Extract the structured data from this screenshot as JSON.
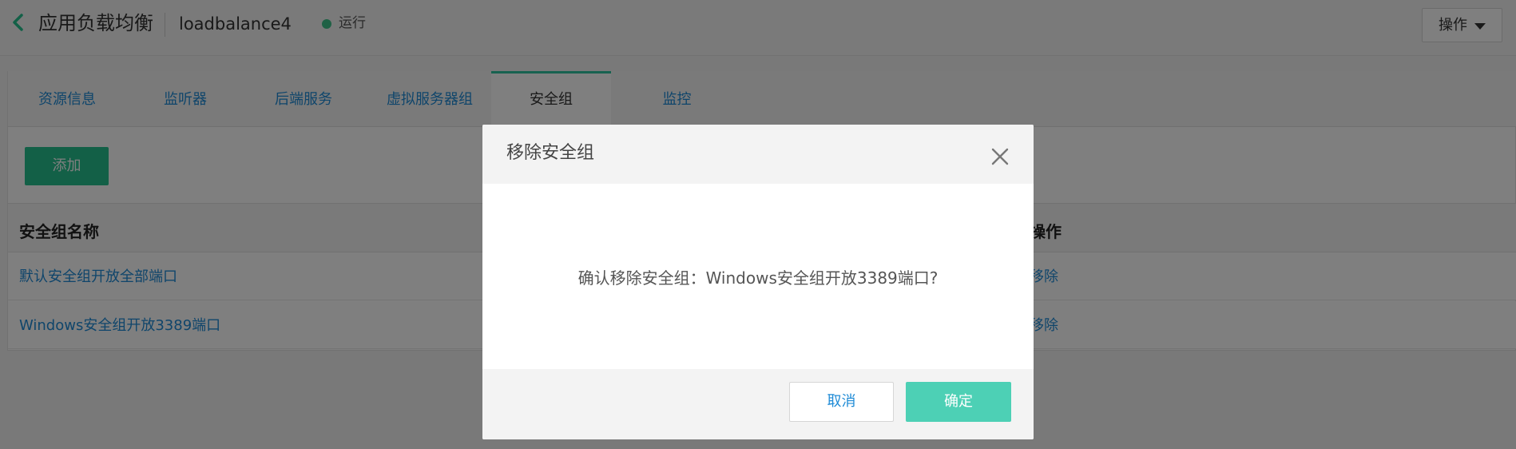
{
  "header": {
    "title": "应用负载均衡",
    "lb_name": "loadbalance4",
    "status": "运行",
    "status_color": "#3fc38a",
    "ops_label": "操作",
    "back_icon": "chevron-left-icon"
  },
  "tabs": [
    {
      "label": "资源信息",
      "active": false
    },
    {
      "label": "监听器",
      "active": false
    },
    {
      "label": "后端服务",
      "active": false
    },
    {
      "label": "虚拟服务器组",
      "active": false
    },
    {
      "label": "安全组",
      "active": true
    },
    {
      "label": "监控",
      "active": false
    }
  ],
  "toolbar": {
    "add_label": "添加"
  },
  "table": {
    "columns": [
      "安全组名称",
      "操作"
    ],
    "rows": [
      {
        "name": "默认安全组开放全部端口",
        "action": "移除"
      },
      {
        "name": "Windows安全组开放3389端口",
        "action": "移除"
      }
    ]
  },
  "modal": {
    "title": "移除安全组",
    "message": "确认移除安全组：Windows安全组开放3389端口?",
    "cancel_label": "取消",
    "confirm_label": "确定",
    "close_icon": "close-icon"
  },
  "colors": {
    "accent": "#26c08f",
    "link": "#1f8bd6",
    "confirm": "#4dd0b5"
  }
}
